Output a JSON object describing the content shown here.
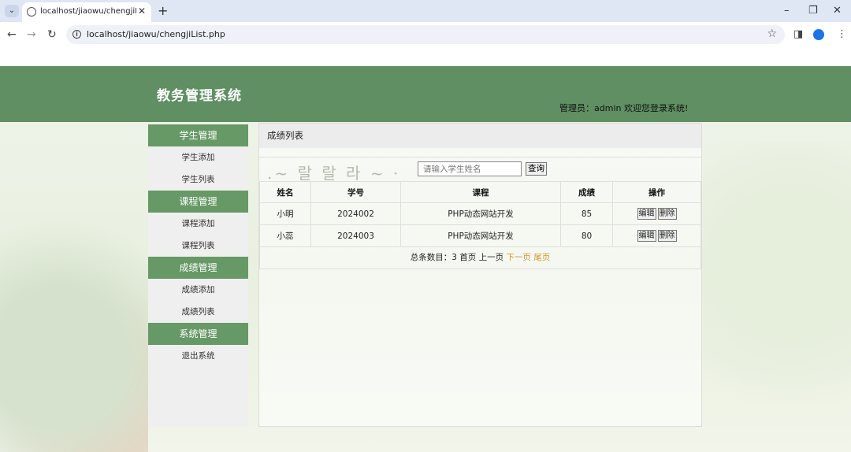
{
  "browser": {
    "tab_title": "localhost/jiaowu/chengjiList.",
    "url": "localhost/jiaowu/chengjiList.php"
  },
  "header": {
    "title": "教务管理系统",
    "welcome": "管理员：admin  欢迎您登录系统!"
  },
  "sidebar": {
    "groups": [
      {
        "title": "学生管理",
        "items": [
          "学生添加",
          "学生列表"
        ]
      },
      {
        "title": "课程管理",
        "items": [
          "课程添加",
          "课程列表"
        ]
      },
      {
        "title": "成绩管理",
        "items": [
          "成绩添加",
          "成绩列表"
        ]
      },
      {
        "title": "系统管理",
        "items": [
          "退出系统"
        ]
      }
    ]
  },
  "main": {
    "title": "成绩列表",
    "search": {
      "placeholder": "请输入学生姓名",
      "button": "查询",
      "decoration": ".~ 랄 랄 라 ~ ·"
    },
    "table": {
      "headers": [
        "姓名",
        "学号",
        "课程",
        "成绩",
        "操作"
      ],
      "rows": [
        {
          "name": "小明",
          "id": "2024002",
          "course": "PHP动态网站开发",
          "score": "85",
          "edit": "编辑",
          "delete": "删除"
        },
        {
          "name": "小蕊",
          "id": "2024003",
          "course": "PHP动态网站开发",
          "score": "80",
          "edit": "编辑",
          "delete": "删除"
        }
      ]
    },
    "pager": {
      "summary": "总条数目：3 首页 上一页",
      "next": "下一页",
      "last": "尾页"
    }
  },
  "colors": {
    "banner": "#5f8f62",
    "sidebar_head": "#669966",
    "pager_link": "#d4952a"
  }
}
